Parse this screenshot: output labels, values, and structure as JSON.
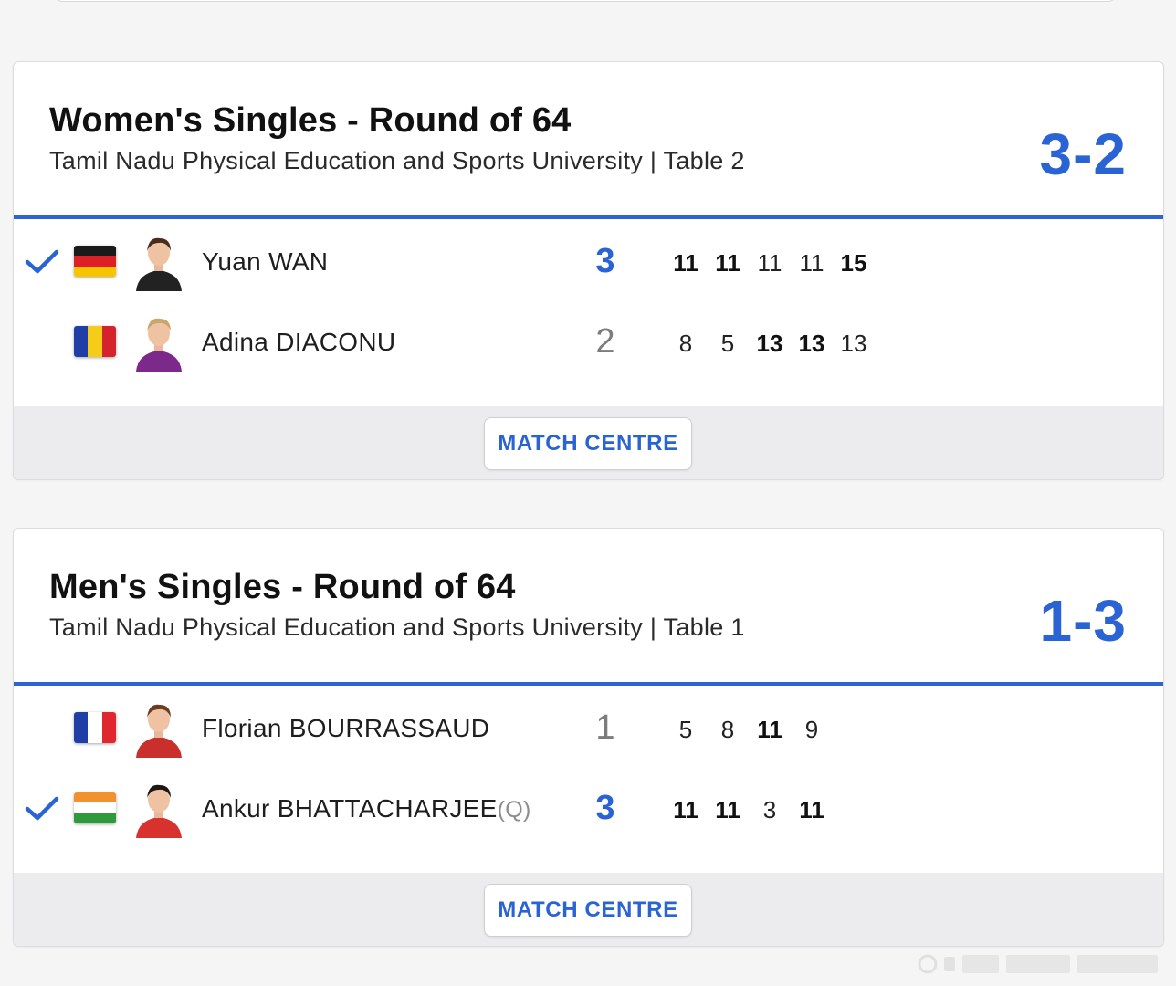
{
  "colors": {
    "accent": "#2a63d4",
    "card_bg": "#ffffff",
    "footer_bg": "#ececee",
    "page_bg": "#f5f5f6"
  },
  "matches": [
    {
      "title": "Women's Singles - Round of 64",
      "venue": "Tamil Nadu Physical Education and Sports University | Table 2",
      "score": "3-2",
      "button": "MATCH CENTRE",
      "players": [
        {
          "name": "Yuan WAN",
          "qualifier": "",
          "country_flag": "Germany",
          "winner": true,
          "sets": "3",
          "games": [
            {
              "v": "11",
              "bold": true
            },
            {
              "v": "11",
              "bold": true
            },
            {
              "v": "11",
              "bold": false
            },
            {
              "v": "11",
              "bold": false
            },
            {
              "v": "15",
              "bold": true
            }
          ]
        },
        {
          "name": "Adina DIACONU",
          "qualifier": "",
          "country_flag": "Romania",
          "winner": false,
          "sets": "2",
          "games": [
            {
              "v": "8",
              "bold": false
            },
            {
              "v": "5",
              "bold": false
            },
            {
              "v": "13",
              "bold": true
            },
            {
              "v": "13",
              "bold": true
            },
            {
              "v": "13",
              "bold": false
            }
          ]
        }
      ]
    },
    {
      "title": "Men's Singles - Round of 64",
      "venue": "Tamil Nadu Physical Education and Sports University | Table 1",
      "score": "1-3",
      "button": "MATCH CENTRE",
      "players": [
        {
          "name": "Florian BOURRASSAUD",
          "qualifier": "",
          "country_flag": "France",
          "winner": false,
          "sets": "1",
          "games": [
            {
              "v": "5",
              "bold": false
            },
            {
              "v": "8",
              "bold": false
            },
            {
              "v": "11",
              "bold": true
            },
            {
              "v": "9",
              "bold": false
            }
          ]
        },
        {
          "name": "Ankur BHATTACHARJEE",
          "qualifier": "(Q)",
          "country_flag": "India",
          "winner": true,
          "sets": "3",
          "games": [
            {
              "v": "11",
              "bold": true
            },
            {
              "v": "11",
              "bold": true
            },
            {
              "v": "3",
              "bold": false
            },
            {
              "v": "11",
              "bold": true
            }
          ]
        }
      ]
    }
  ]
}
